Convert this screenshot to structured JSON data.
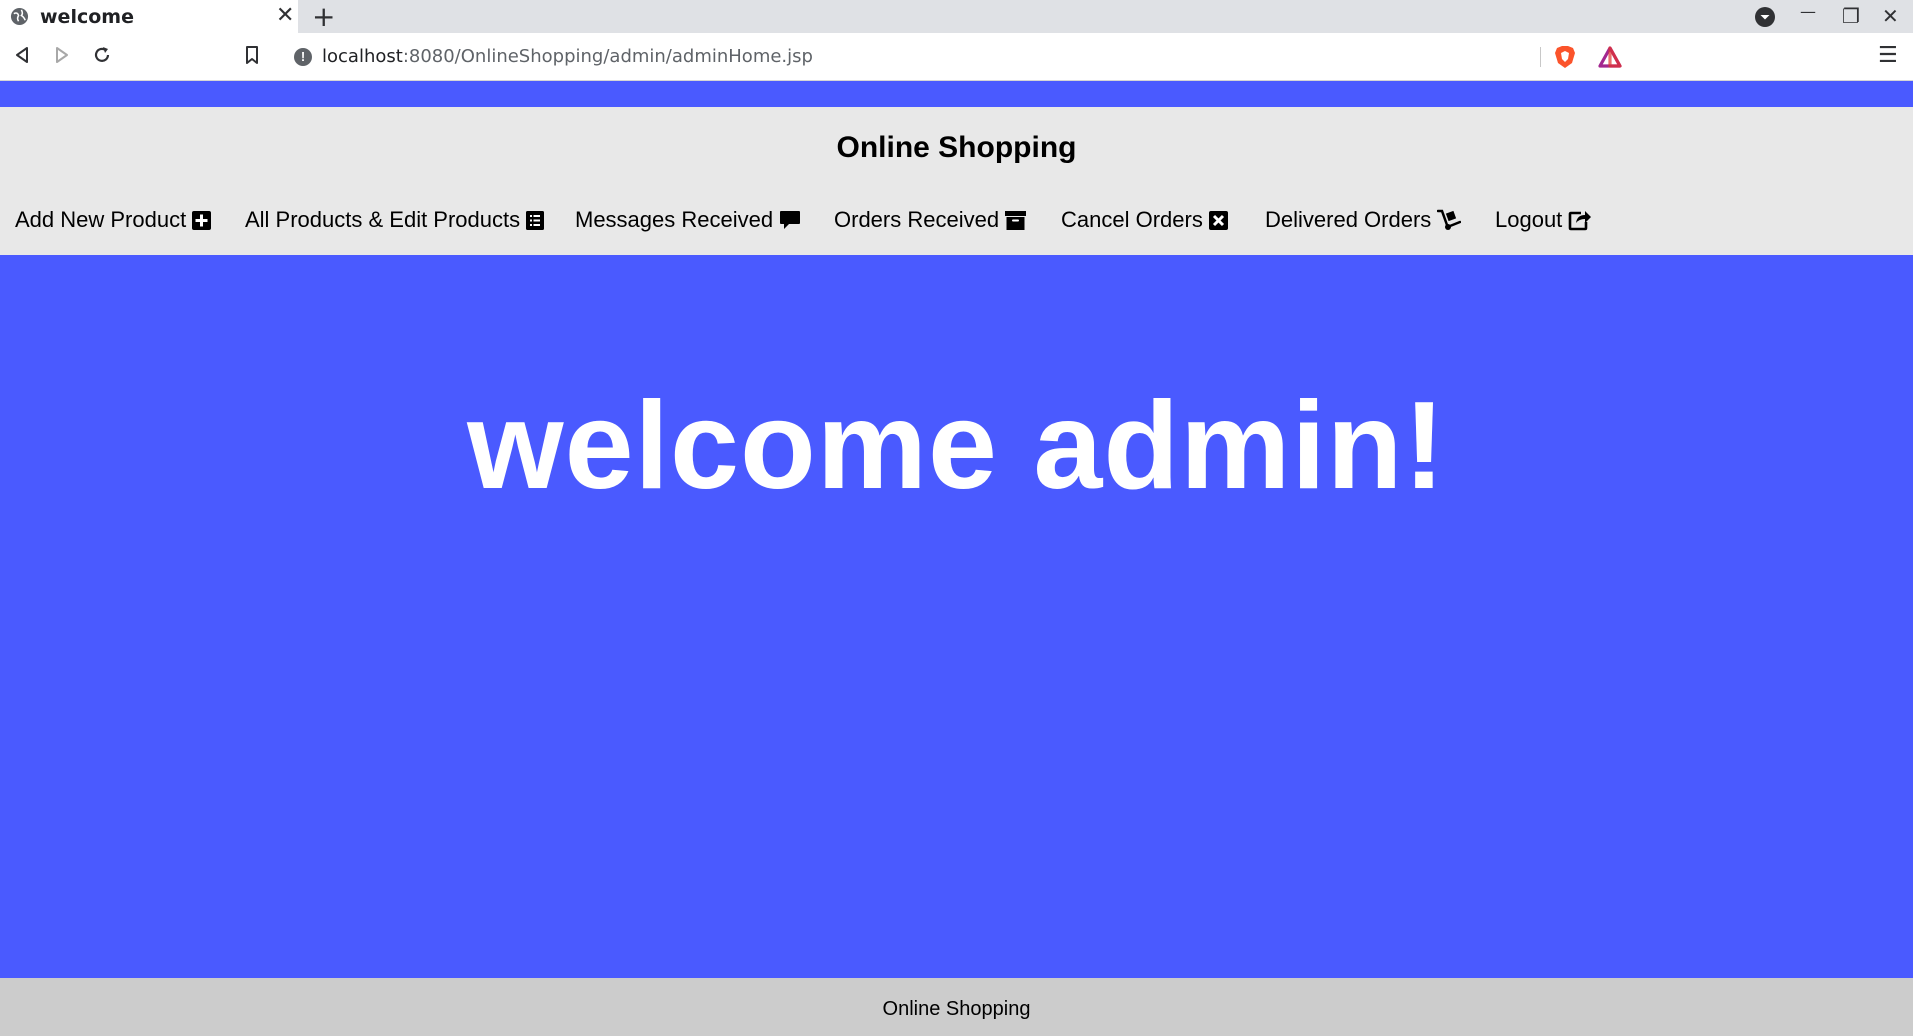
{
  "browser": {
    "tab_title": "welcome",
    "tab_close": "✕",
    "new_tab": "+",
    "url_host": "localhost",
    "url_path": ":8080/OnlineShopping/admin/adminHome.jsp",
    "info_glyph": "!",
    "menu_glyph": "☰",
    "minimize_glyph": "—",
    "restore_glyph": "❐",
    "close_glyph": "✕"
  },
  "header": {
    "title": "Online Shopping"
  },
  "nav": {
    "items": [
      {
        "label": "Add New Product",
        "icon": "plus-square-icon"
      },
      {
        "label": "All Products & Edit Products",
        "icon": "list-icon"
      },
      {
        "label": "Messages Received",
        "icon": "comment-icon"
      },
      {
        "label": "Orders Received",
        "icon": "archive-icon"
      },
      {
        "label": "Cancel Orders",
        "icon": "close-square-icon"
      },
      {
        "label": "Delivered Orders",
        "icon": "dolly-icon"
      },
      {
        "label": "Logout",
        "icon": "share-square-icon"
      }
    ]
  },
  "main": {
    "welcome_text": "welcome admin!"
  },
  "footer": {
    "text": "Online Shopping"
  },
  "colors": {
    "page_background": "#4a5aff",
    "header_background": "#e8e8e8",
    "footer_background": "#cccccc",
    "welcome_text": "#ffffff"
  }
}
